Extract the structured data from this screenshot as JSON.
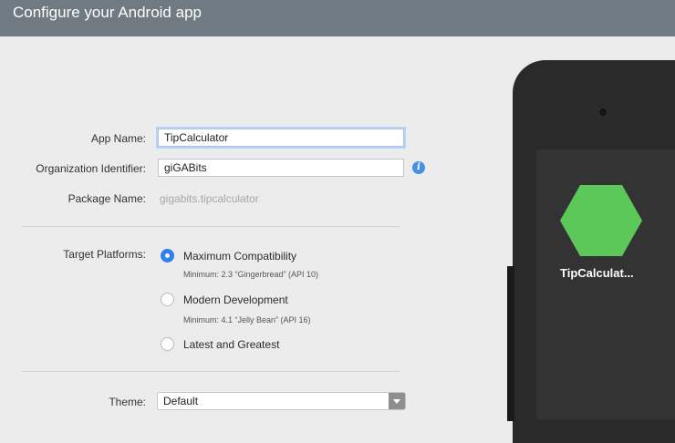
{
  "header": {
    "title": "Configure your Android app"
  },
  "form": {
    "app_name_label": "App Name:",
    "app_name_value": "TipCalculator",
    "org_id_label": "Organization Identifier:",
    "org_id_value": "giGABits",
    "package_label": "Package Name:",
    "package_value": "gigabits.tipcalculator",
    "target_label": "Target Platforms:",
    "platforms": [
      {
        "label": "Maximum Compatibility",
        "sub": "Minimum: 2.3 “Gingerbread” (API 10)",
        "checked": true
      },
      {
        "label": "Modern Development",
        "sub": "Minimum: 4.1 “Jelly Bean” (API 16)",
        "checked": false
      },
      {
        "label": "Latest and Greatest",
        "sub": "",
        "checked": false
      }
    ],
    "theme_label": "Theme:",
    "theme_value": "Default"
  },
  "preview": {
    "app_name": "TipCalculat...",
    "icon_color": "#5dc85a"
  },
  "colors": {
    "header_bg": "#6f7a82",
    "accent": "#2f80ed"
  }
}
